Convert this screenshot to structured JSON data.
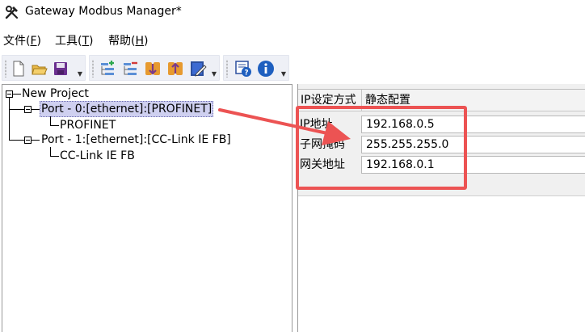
{
  "window": {
    "title": "Gateway Modbus Manager*",
    "icon": "hammer-wrench-icon"
  },
  "menu": {
    "items": [
      {
        "text": "文件(",
        "key": "F",
        "close": ")"
      },
      {
        "text": "工具(",
        "key": "T",
        "close": ")"
      },
      {
        "text": "帮助(",
        "key": "H",
        "close": ")"
      }
    ]
  },
  "toolbar": {
    "group1": [
      "new-file-icon",
      "open-folder-icon",
      "save-icon"
    ],
    "group2": [
      "add-node-icon",
      "remove-node-icon",
      "import-icon",
      "export-icon",
      "edit-icon"
    ],
    "group3": [
      "help-icon",
      "info-icon"
    ]
  },
  "tree": {
    "root": "New Project",
    "ports": [
      {
        "label": "Port - 0:[ethernet]:[PROFINET]",
        "child": "PROFINET",
        "selected": true
      },
      {
        "label": "Port - 1:[ethernet]:[CC-Link IE FB]",
        "child": "CC-Link IE FB",
        "selected": false
      }
    ]
  },
  "properties": {
    "header": {
      "name": "IP设定方式",
      "value": "静态配置"
    },
    "rows": [
      {
        "label": "IP地址",
        "value": "192.168.0.5"
      },
      {
        "label": "子网掩码",
        "value": "255.255.255.0"
      },
      {
        "label": "网关地址",
        "value": "192.168.0.1"
      }
    ]
  },
  "annotation": {
    "color": "#ec5353"
  }
}
